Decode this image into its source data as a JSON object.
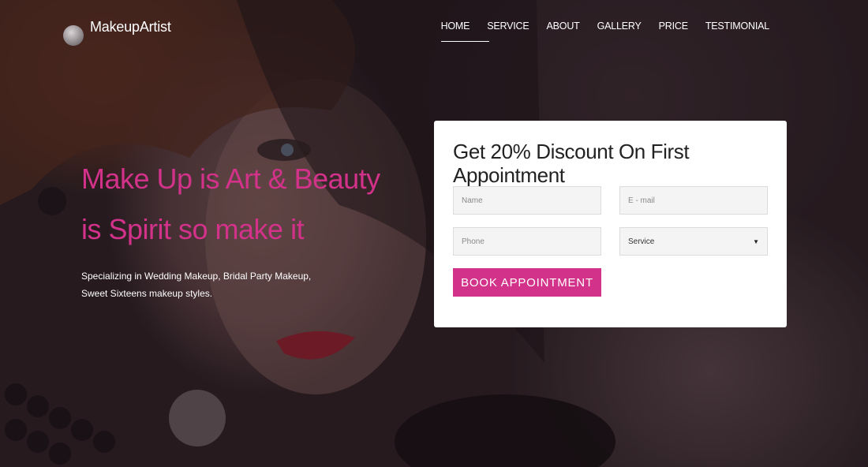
{
  "brand": {
    "name": "MakeupArtist"
  },
  "nav": {
    "items": [
      {
        "label": "HOME",
        "active": true
      },
      {
        "label": "SERVICE",
        "active": false
      },
      {
        "label": "ABOUT",
        "active": false
      },
      {
        "label": "GALLERY",
        "active": false
      },
      {
        "label": "PRICE",
        "active": false
      },
      {
        "label": "TESTIMONIAL",
        "active": false
      }
    ]
  },
  "hero": {
    "heading_line1": "Make Up is Art & Beauty",
    "heading_line2": "is Spirit so make it",
    "sub_line1": "Specializing in Wedding Makeup, Bridal Party Makeup,",
    "sub_line2": "Sweet Sixteens makeup styles."
  },
  "booking": {
    "title": "Get 20% Discount On First Appointment",
    "name_placeholder": "Name",
    "email_placeholder": "E - mail",
    "phone_placeholder": "Phone",
    "service_selected": "Service",
    "button_label": "BOOK APPOINTMENT"
  },
  "colors": {
    "accent": "#d3328a",
    "card_bg": "#ffffff",
    "nav_text": "#ffffff"
  }
}
